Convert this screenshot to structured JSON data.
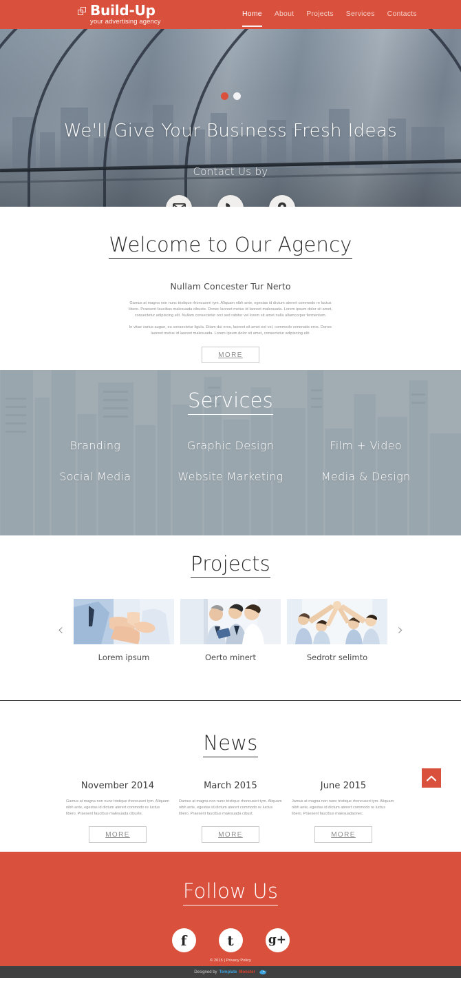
{
  "theme": {
    "brand": "#d9503c",
    "dark": "#404040",
    "body_text": "#8f8f8f"
  },
  "header": {
    "logo": {
      "icon": "overlapping-squares-icon",
      "title": "Build-Up",
      "tagline": "your advertising agency"
    },
    "nav": [
      {
        "label": "Home",
        "active": true
      },
      {
        "label": "About",
        "active": false
      },
      {
        "label": "Projects",
        "active": false
      },
      {
        "label": "Services",
        "active": false
      },
      {
        "label": "Contacts",
        "active": false
      }
    ]
  },
  "hero": {
    "slider_dots": [
      {
        "active": true
      },
      {
        "active": false
      }
    ],
    "title": "We'll Give Your Business Fresh Ideas",
    "subtitle": "Contact Us by",
    "contacts": [
      {
        "icon": "envelope-icon",
        "name": "email"
      },
      {
        "icon": "phone-icon",
        "name": "phone"
      },
      {
        "icon": "map-pin-icon",
        "name": "location"
      }
    ]
  },
  "welcome": {
    "title": "Welcome to Our Agency",
    "subtitle": "Nullam Concester Tur Nerto",
    "paragraphs": [
      "Gamus at magna non nunc tristique rhoncuseri tym. Aliquam nibh ante, egestas id dictum aterert commodo re luctus libero. Praesent faucibus malesuada cibuste. Donec laoreet metus id laoreet malesuada. Lorem ipsum dolor sit amet, consectetur adipiscing elit. Nullam consectetur orci sed rabitur vel lorem sit amet nulla ullamcorper fermentum.",
      "In vitae varius augue, eu consectetur ligula. Etiam dui eros, laoreet sit amet est vel, commodo venenatis eros. Donec laoreet metus id laoreet malesuada. Lorem ipsum dolor sit amet, consectetur adipiscing elit."
    ],
    "more_label": "MORE"
  },
  "services": {
    "title": "Services",
    "items": [
      {
        "label": "Branding"
      },
      {
        "label": "Graphic Design"
      },
      {
        "label": "Film + Video"
      },
      {
        "label": "Social Media"
      },
      {
        "label": "Website Marketing"
      },
      {
        "label": "Media & Design"
      }
    ]
  },
  "projects": {
    "title": "Projects",
    "prev_icon": "chevron-left-icon",
    "next_icon": "chevron-right-icon",
    "items": [
      {
        "caption": "Lorem ipsum"
      },
      {
        "caption": "Oerto minert"
      },
      {
        "caption": "Sedrotr selimto"
      }
    ]
  },
  "news": {
    "title": "News",
    "scroll_top_icon": "chevron-up-icon",
    "items": [
      {
        "date": "November 2014",
        "text": "Gamus at magna non nunc tristique rhoncuseri tym. Aliquam nibh ante, egestas id dictum aterert commodo re luctus libero. Praesent faucibus malesuada cibuste.",
        "more_label": "MORE"
      },
      {
        "date": "March 2015",
        "text": "Damus at magna non nunc tristique rhoncuseri tym. Aliquam nibh ante, egestas id dictum aterert commodo re luctus libero. Praesent faucibus malesuada cibust.",
        "more_label": "MORE"
      },
      {
        "date": "June 2015",
        "text": "Jamus at magna non nunc tristique rhoncuseri tym. Aliquam nibh ante, egestas id dictum aterert commodo re luctus libero. Praesent faucibus malesuadaonec.",
        "more_label": "MORE"
      }
    ]
  },
  "footer": {
    "title": "Follow Us",
    "social": [
      {
        "name": "facebook-icon",
        "glyph": "f"
      },
      {
        "name": "tumblr-icon",
        "glyph": "t"
      },
      {
        "name": "google-plus-icon",
        "glyph": "g+"
      }
    ],
    "copyright": "© 2015 | ",
    "privacy_label": "Privacy Policy",
    "designed_prefix": "Designed by ",
    "designed_brand_1": "Template",
    "designed_brand_2": "Monster"
  }
}
